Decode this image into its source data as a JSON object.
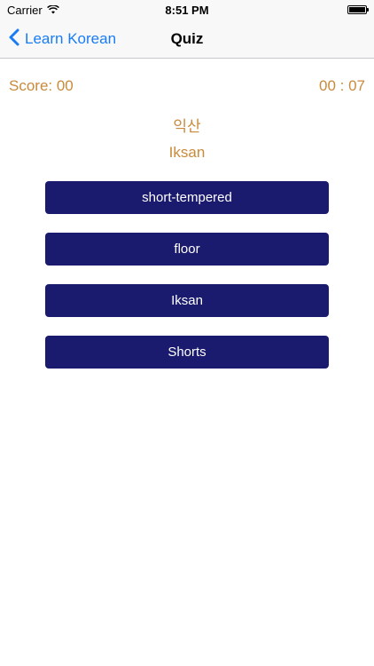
{
  "status_bar": {
    "carrier": "Carrier",
    "time": "8:51 PM"
  },
  "nav": {
    "back_label": "Learn Korean",
    "title": "Quiz"
  },
  "quiz": {
    "score": "Score: 00",
    "timer": "00 : 07",
    "korean_word": "익산",
    "romanization": "Iksan",
    "answers": [
      {
        "label": "short-tempered"
      },
      {
        "label": "floor"
      },
      {
        "label": "Iksan"
      },
      {
        "label": "Shorts"
      }
    ]
  },
  "colors": {
    "accent_blue": "#1a7cf4",
    "text_orange": "#c98a3b",
    "button_navy": "#1a1a6e"
  },
  "icons": {
    "back": "chevron-left-icon",
    "wifi": "wifi-icon",
    "battery": "battery-icon"
  }
}
